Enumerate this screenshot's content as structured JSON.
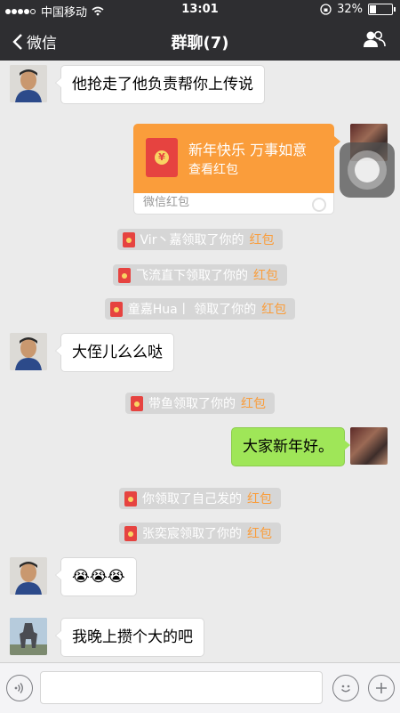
{
  "status": {
    "carrier": "中国移动",
    "time": "13:01",
    "battery": "32%",
    "battery_level": 0.32
  },
  "nav": {
    "back_label": "微信",
    "title": "群聊(7)"
  },
  "messages": [
    {
      "text": "他抢走了他负责帮你上传说"
    },
    {
      "text": "大侄儿么么哒"
    },
    {
      "text": "大家新年好。"
    },
    {
      "text": "😭😭😭"
    },
    {
      "text": "我晚上攒个大的吧"
    }
  ],
  "red_packet": {
    "greeting": "新年快乐 万事如意",
    "action": "查看红包",
    "footer": "微信红包"
  },
  "notices": [
    {
      "prefix": "Vir丶嘉领取了你的",
      "highlight": "红包"
    },
    {
      "prefix": "飞流直下领取了你的",
      "highlight": "红包"
    },
    {
      "prefix": "童嘉Hua丨 领取了你的",
      "highlight": "红包"
    },
    {
      "prefix": "带鱼领取了你的",
      "highlight": "红包"
    },
    {
      "prefix": "你领取了自己发的",
      "highlight": "红包"
    },
    {
      "prefix": "张奕宸领取了你的",
      "highlight": "红包"
    }
  ],
  "input": {
    "value": ""
  },
  "colors": {
    "accent_orange": "#fa9d3b",
    "bubble_green": "#9fe658",
    "nav_bg": "#2e2e31"
  }
}
